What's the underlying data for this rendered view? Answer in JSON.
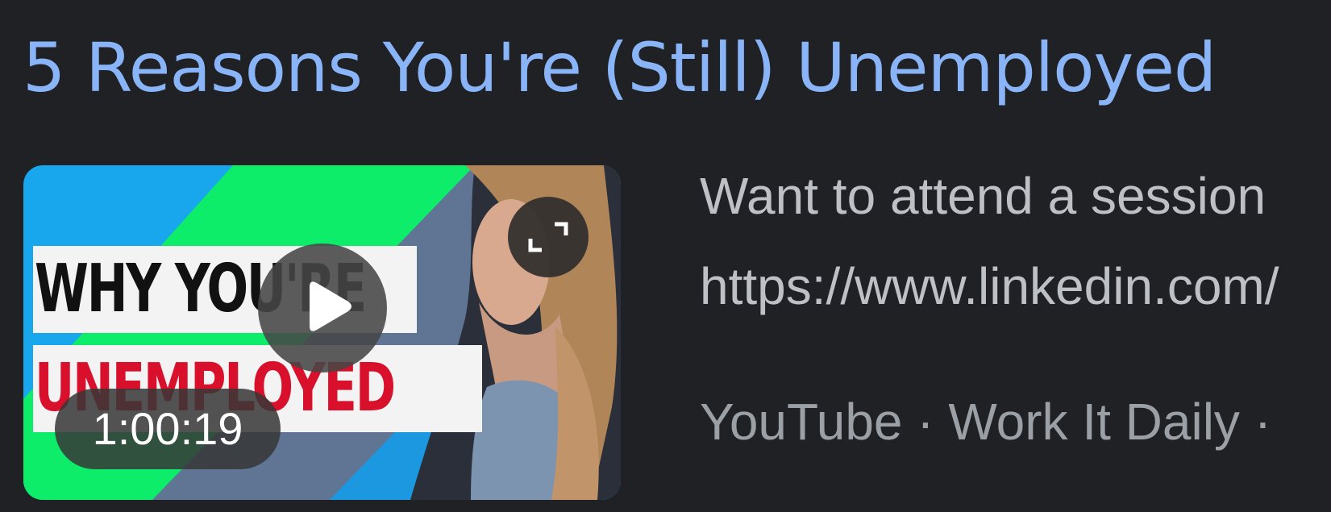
{
  "result": {
    "title": "5 Reasons You're (Still) Unemployed",
    "snippet_line1": "Want to attend a session",
    "snippet_line2": "https://www.linkedin.com/",
    "source": "YouTube · Work It Daily ·"
  },
  "video": {
    "duration": "1:00:19",
    "thumbnail_text_line1": "WHY YOU'RE",
    "thumbnail_text_line2": "UNEMPLOYED"
  },
  "colors": {
    "background": "#202124",
    "title_link": "#8ab4f8",
    "snippet_text": "#bdc1c6",
    "source_text": "#9aa0a6"
  },
  "icons": {
    "play": "play-icon",
    "expand": "expand-icon"
  }
}
